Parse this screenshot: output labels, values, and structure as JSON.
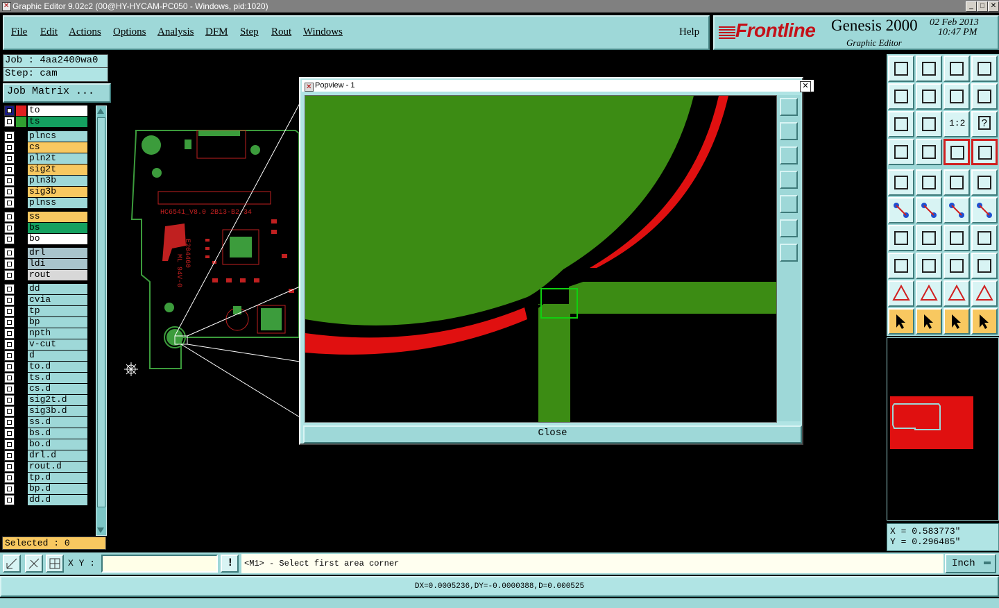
{
  "window": {
    "title": "Graphic Editor 9.02c2 (00@HY-HYCAM-PC050 - Windows, pid:1020)",
    "controls": [
      "_",
      "□",
      "✕"
    ]
  },
  "menu": {
    "file": "File",
    "edit": "Edit",
    "actions": "Actions",
    "options": "Options",
    "analysis": "Analysis",
    "dfm": "DFM",
    "step": "Step",
    "rout": "Rout",
    "windows": "Windows",
    "help": "Help"
  },
  "brand": {
    "logo": "Frontline",
    "product": "Genesis 2000",
    "subtitle": "Graphic Editor",
    "date": "02 Feb 2013",
    "time": "10:47 PM"
  },
  "job": {
    "job_label": "Job : 4aa2400wa0",
    "step_label": "Step: cam",
    "matrix_button": "Job Matrix ..."
  },
  "layers": [
    {
      "name": "to",
      "color": "#ffffff",
      "swatch": "#e02020",
      "box": "#1a1a80"
    },
    {
      "name": "ts",
      "color": "#14a060",
      "swatch": "#30a030"
    },
    {
      "name": "plncs",
      "color": "#9ed8d8"
    },
    {
      "name": "cs",
      "color": "#f8c860"
    },
    {
      "name": "pln2t",
      "color": "#9ed8d8"
    },
    {
      "name": "sig2t",
      "color": "#f8c860"
    },
    {
      "name": "pln3b",
      "color": "#9ed8d8"
    },
    {
      "name": "sig3b",
      "color": "#f8c860"
    },
    {
      "name": "plnss",
      "color": "#9ed8d8"
    },
    {
      "name": "ss",
      "color": "#f8c860"
    },
    {
      "name": "bs",
      "color": "#14a060"
    },
    {
      "name": "bo",
      "color": "#ffffff"
    },
    {
      "name": "drl",
      "color": "#a8c4cc"
    },
    {
      "name": "ldi",
      "color": "#a8c4cc"
    },
    {
      "name": "rout",
      "color": "#d8d8d8"
    },
    {
      "name": "dd",
      "color": "#9ed8d8"
    },
    {
      "name": "cvia",
      "color": "#9ed8d8"
    },
    {
      "name": "tp",
      "color": "#9ed8d8"
    },
    {
      "name": "bp",
      "color": "#9ed8d8"
    },
    {
      "name": "npth",
      "color": "#9ed8d8"
    },
    {
      "name": "v-cut",
      "color": "#9ed8d8"
    },
    {
      "name": "d",
      "color": "#9ed8d8"
    },
    {
      "name": "to.d",
      "color": "#9ed8d8"
    },
    {
      "name": "ts.d",
      "color": "#9ed8d8"
    },
    {
      "name": "cs.d",
      "color": "#9ed8d8"
    },
    {
      "name": "sig2t.d",
      "color": "#9ed8d8"
    },
    {
      "name": "sig3b.d",
      "color": "#9ed8d8"
    },
    {
      "name": "ss.d",
      "color": "#9ed8d8"
    },
    {
      "name": "bs.d",
      "color": "#9ed8d8"
    },
    {
      "name": "bo.d",
      "color": "#9ed8d8"
    },
    {
      "name": "drl.d",
      "color": "#9ed8d8"
    },
    {
      "name": "rout.d",
      "color": "#9ed8d8"
    },
    {
      "name": "tp.d",
      "color": "#9ed8d8"
    },
    {
      "name": "bp.d",
      "color": "#9ed8d8"
    },
    {
      "name": "dd.d",
      "color": "#9ed8d8"
    }
  ],
  "selected": "Selected : 0",
  "board_silkscreen": {
    "line1": "HC6541_V8.0  2B13-B2-34",
    "line2": "E204460",
    "line3": "ML 94V-0"
  },
  "popview": {
    "title": "Popview - 1",
    "close_x": "✕",
    "close_button": "Close"
  },
  "tool_labels": {
    "ratio": "1:2",
    "help": "?"
  },
  "coords": {
    "x": "X  = 0.583773\"",
    "y": "Y  = 0.296485\""
  },
  "bottom": {
    "xy_label": "X Y :",
    "xy_value": "",
    "alert": "!",
    "prompt": "<M1> - Select first area corner",
    "unit": "Inch"
  },
  "status": "DX=0.0005236,DY=-0.0000388,D=0.000525",
  "colors": {
    "accent_cyan": "#9ed8d8",
    "signal_orange": "#f8c860",
    "copper_green": "#3c8c14",
    "mask_red": "#e01010"
  }
}
